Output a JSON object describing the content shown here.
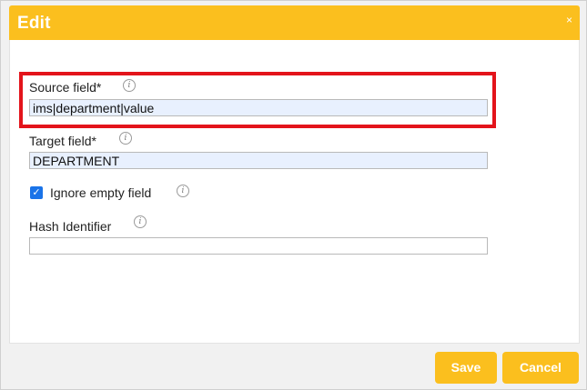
{
  "dialog": {
    "title": "Edit",
    "close_icon": "×"
  },
  "fields": {
    "source": {
      "label": "Source field*",
      "value": "ims|department|value"
    },
    "target": {
      "label": "Target field*",
      "value": "DEPARTMENT"
    },
    "ignore_empty": {
      "label": "Ignore empty field",
      "checked": true
    },
    "hash": {
      "label": "Hash Identifier",
      "value": ""
    }
  },
  "info_icon": "i",
  "checkmark": "✓",
  "buttons": {
    "save": "Save",
    "cancel": "Cancel"
  },
  "colors": {
    "accent": "#fbbf1e",
    "highlight": "#e3141b",
    "checkbox": "#1a73e8",
    "input_fill": "#e8f0fe"
  }
}
